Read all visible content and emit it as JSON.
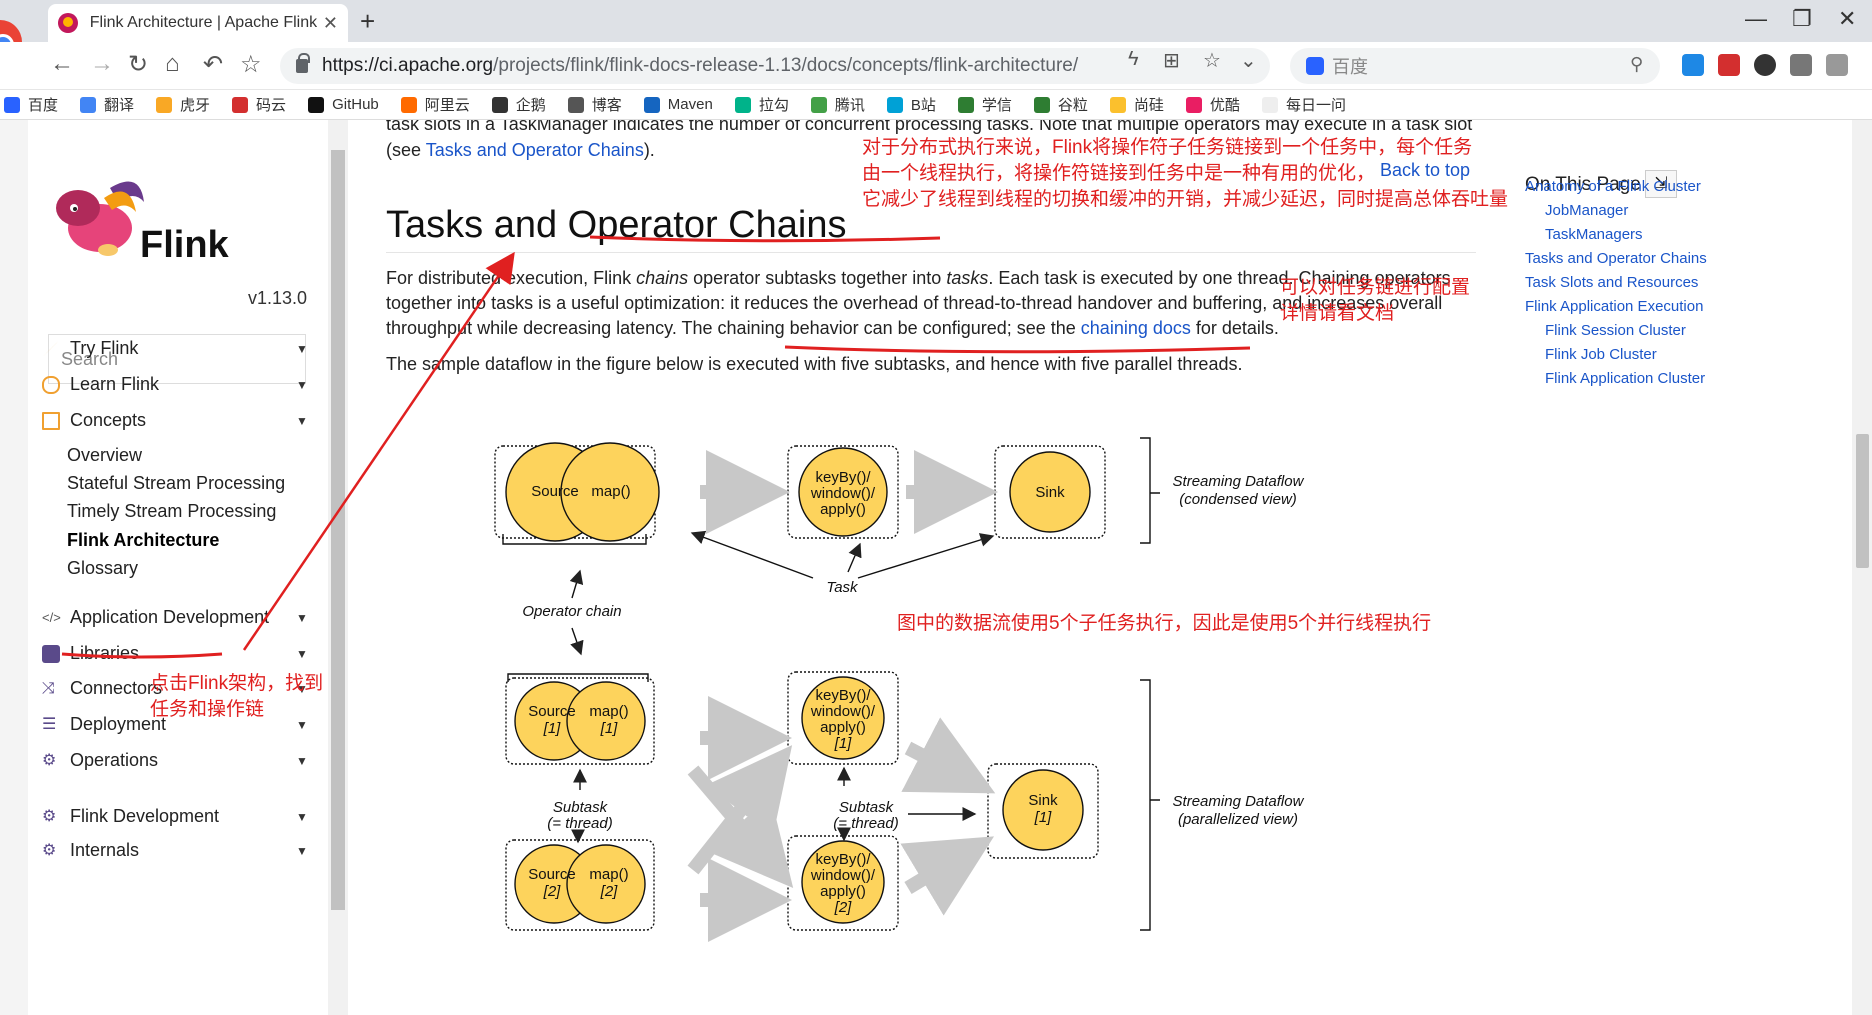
{
  "browser": {
    "tab_title": "Flink Architecture | Apache Flink",
    "tab_close": "✕",
    "new_tab": "+",
    "url_host": "https://ci.apache.org",
    "url_path": "/projects/flink/flink-docs-release-1.13/docs/concepts/flink-architecture/",
    "search_engine_text": "百度",
    "window_controls": [
      "—",
      "❐",
      "✕"
    ]
  },
  "bookmarks": [
    {
      "label": "百度",
      "color": "#2962ff"
    },
    {
      "label": "翻译",
      "color": "#4285f4"
    },
    {
      "label": "虎牙",
      "color": "#f9a825"
    },
    {
      "label": "码云",
      "color": "#d32f2f"
    },
    {
      "label": "GitHub",
      "color": "#111111"
    },
    {
      "label": "阿里云",
      "color": "#ff6a00"
    },
    {
      "label": "企鹅",
      "color": "#333333"
    },
    {
      "label": "博客",
      "color": "#555555"
    },
    {
      "label": "Maven",
      "color": "#1565c0"
    },
    {
      "label": "拉勾",
      "color": "#00b38a"
    },
    {
      "label": "腾讯",
      "color": "#43a047"
    },
    {
      "label": "B站",
      "color": "#00a1d6"
    },
    {
      "label": "学信",
      "color": "#2e7d32"
    },
    {
      "label": "谷粒",
      "color": "#2e7d32"
    },
    {
      "label": "尚硅",
      "color": "#fbc02d"
    },
    {
      "label": "优酷",
      "color": "#e91e63"
    },
    {
      "label": "每日一问",
      "color": "#eeeeee"
    }
  ],
  "sidebar": {
    "logo_text": "Flink",
    "version": "v1.13.0",
    "search_placeholder": "Search",
    "nav": [
      {
        "label": "Try Flink",
        "icon": "rocket-icon",
        "color": "#f0a030"
      },
      {
        "label": "Learn Flink",
        "icon": "hand-icon",
        "color": "#f0a030"
      },
      {
        "label": "Concepts",
        "icon": "book-icon",
        "color": "#f0a030"
      }
    ],
    "concepts": [
      "Overview",
      "Stateful Stream Processing",
      "Timely Stream Processing",
      "Flink Architecture",
      "Glossary"
    ],
    "nav2": [
      {
        "label": "Application Development",
        "icon": "code-icon"
      },
      {
        "label": "Libraries",
        "icon": "library-icon"
      },
      {
        "label": "Connectors",
        "icon": "shuffle-icon"
      },
      {
        "label": "Deployment",
        "icon": "sliders-icon"
      },
      {
        "label": "Operations",
        "icon": "gears-icon"
      },
      {
        "label": "Flink Development",
        "icon": "gears-icon"
      },
      {
        "label": "Internals",
        "icon": "gears-icon"
      }
    ]
  },
  "content": {
    "intro_line1": "task slots in a TaskManager indicates the number of concurrent processing tasks. Note that multiple operators may execute in a task slot",
    "intro_line2_pre": "(see ",
    "intro_line2_link": "Tasks and Operator Chains",
    "intro_line2_post": ").",
    "heading": "Tasks and Operator Chains",
    "p1_a": "For distributed execution, Flink ",
    "p1_chains": "chains",
    "p1_b": " operator subtasks together into ",
    "p1_tasks": "tasks",
    "p1_c": ". Each task is executed by one thread. Chaining operators",
    "p1_line2": "together into tasks is a useful optimization: it reduces the overhead of thread-to-thread handover and buffering, and increases overall",
    "p1_line3_a": "throughput while decreasing latency. The chaining behavior can be configured; see the ",
    "p1_line3_link": "chaining docs",
    "p1_line3_b": " for details.",
    "p2": "The sample dataflow in the figure below is executed with five subtasks, and hence with five parallel threads."
  },
  "diagram": {
    "source": "Source",
    "map": "map()",
    "keyby_l1": "keyBy()/",
    "keyby_l2": "window()/",
    "keyby_l3": "apply()",
    "sink": "Sink",
    "task": "Task",
    "operator_chain": "Operator chain",
    "condensed_l1": "Streaming Dataflow",
    "condensed_l2": "(condensed view)",
    "parallel_l1": "Streaming Dataflow",
    "parallel_l2": "(parallelized view)",
    "subtask_l1": "Subtask",
    "subtask_l2": "(= thread)",
    "idx1": "[1]",
    "idx2": "[2]",
    "node_color": "#fdd35c"
  },
  "toc": {
    "title": "On This Page",
    "pin": "⇲",
    "items": [
      "Anatomy of a Flink Cluster",
      "JobManager",
      "TaskManagers",
      "Tasks and Operator Chains",
      "Task Slots and Resources",
      "Flink Application Execution",
      "Flink Session Cluster",
      "Flink Job Cluster",
      "Flink Application Cluster"
    ]
  },
  "back_to_top": "Back to top",
  "annotations": {
    "top_l1": "对于分布式执行来说，Flink将操作符子任务链接到一个任务中，每个任务",
    "top_l2": "由一个线程执行，将操作符链接到任务中是一种有用的优化，",
    "top_l3": "它减少了线程到线程的切换和缓冲的开销，并减少延迟，同时提高总体吞吐量",
    "config_l1": "可以对任务链进行配置",
    "config_l2": "详情请看文档",
    "middle": "图中的数据流使用5个子任务执行，因此是使用5个并行线程执行",
    "left_l1": "点击Flink架构，找到",
    "left_l2": "任务和操作链",
    "color": "#e02020"
  }
}
